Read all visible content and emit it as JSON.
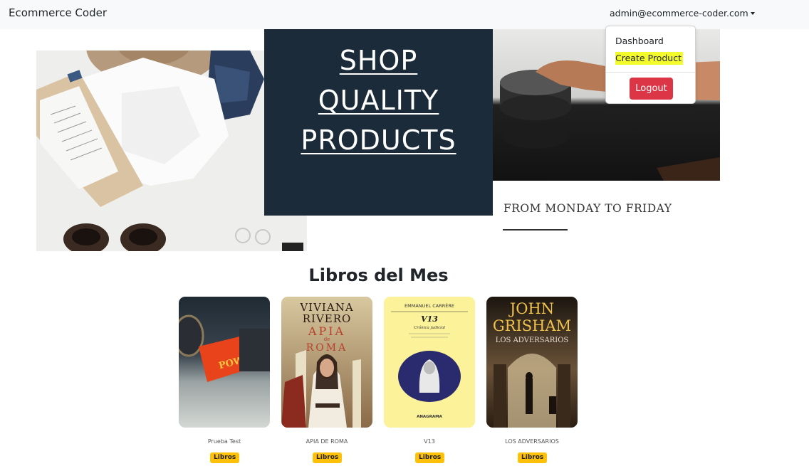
{
  "navbar": {
    "brand": "Ecommerce Coder",
    "user_email": "admin@ecommerce-coder.com"
  },
  "dropdown": {
    "items": [
      {
        "label": "Dashboard"
      },
      {
        "label": "Create Product",
        "highlight": "#f4fb2c"
      }
    ],
    "logout_label": "Logout",
    "logout_color": "#dc3545"
  },
  "hero": {
    "lines": [
      "SHOP",
      "QUALITY",
      "PRODUCTS"
    ],
    "subtitle": "FROM MONDAY TO FRIDAY",
    "panel_color": "#1c2b39"
  },
  "section": {
    "title": "Libros del Mes"
  },
  "books": [
    {
      "title": "Prueba Test",
      "category": "Libros",
      "cover": {
        "spine": "POWER"
      }
    },
    {
      "title": "APIA DE ROMA",
      "category": "Libros",
      "cover": {
        "line1": "VIVIANA",
        "line2": "RIVERO",
        "line3": "APIA",
        "line4": "de",
        "line5": "ROMA"
      }
    },
    {
      "title": "V13",
      "category": "Libros",
      "cover": {
        "author": "EMMANUEL CARRÈRE",
        "title": "V13",
        "subtitle": "Crónica judicial",
        "publisher": "ANAGRAMA"
      }
    },
    {
      "title": "LOS ADVERSARIOS",
      "category": "Libros",
      "cover": {
        "author_first": "JOHN",
        "author_last": "GRISHAM",
        "title": "LOS ADVERSARIOS"
      }
    }
  ],
  "colors": {
    "badge": "#ffc107",
    "navbar_bg": "#f8f9fa"
  }
}
